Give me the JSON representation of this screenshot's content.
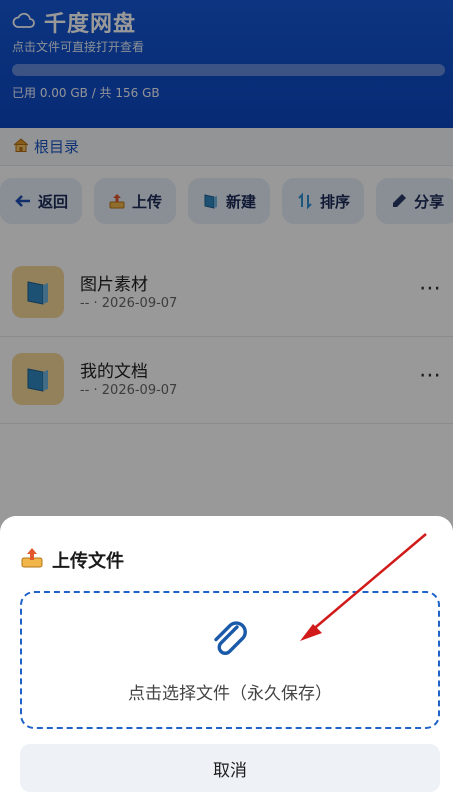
{
  "header": {
    "app_name": "千度网盘",
    "subtitle": "点击文件可直接打开查看",
    "usage_text": "已用 0.00 GB / 共 156 GB",
    "usage_fraction": 0.0
  },
  "breadcrumb": {
    "label": "根目录"
  },
  "toolbar": {
    "items": [
      {
        "label": "返回",
        "icon": "arrow-left-icon"
      },
      {
        "label": "上传",
        "icon": "upload-tray-icon"
      },
      {
        "label": "新建",
        "icon": "folder-icon"
      },
      {
        "label": "排序",
        "icon": "sort-arrows-icon"
      },
      {
        "label": "分享",
        "icon": "pen-icon"
      }
    ]
  },
  "files": [
    {
      "name": "图片素材",
      "meta": "-- · 2026-09-07",
      "more": "⋯",
      "icon": "folder-icon"
    },
    {
      "name": "我的文档",
      "meta": "-- · 2026-09-07",
      "more": "⋯",
      "icon": "folder-icon"
    }
  ],
  "upload_sheet": {
    "title": "上传文件",
    "dropzone_hint": "点击选择文件（永久保存）",
    "cancel_label": "取消",
    "icon": "paperclip-icon"
  },
  "colors": {
    "header_bg": "#0d47c2",
    "accent": "#1f63c9",
    "annotation_arrow": "#d11a1a"
  }
}
